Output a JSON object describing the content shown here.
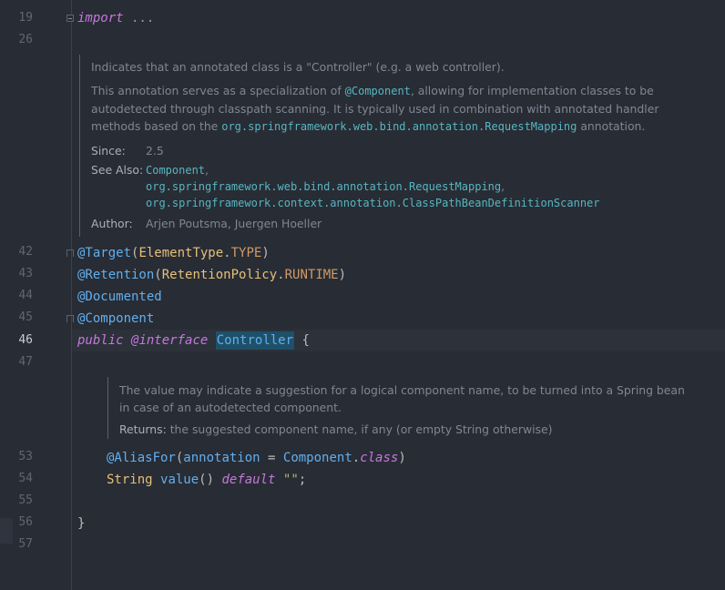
{
  "line_numbers": {
    "l19": "19",
    "l26": "26",
    "l42": "42",
    "l43": "43",
    "l44": "44",
    "l45": "45",
    "l46": "46",
    "l47": "47",
    "l53": "53",
    "l54": "54",
    "l55": "55",
    "l56": "56",
    "l57": "57"
  },
  "code": {
    "import_kw": "import",
    "import_ellipsis": " ...",
    "target_ann": "@Target",
    "target_open": "(",
    "target_cls": "ElementType",
    "target_dot": ".",
    "target_const": "TYPE",
    "target_close": ")",
    "retention_ann": "@Retention",
    "retention_open": "(",
    "retention_cls": "RetentionPolicy",
    "retention_dot": ".",
    "retention_const": "RUNTIME",
    "retention_close": ")",
    "documented_ann": "@Documented",
    "component_ann": "@Component",
    "public_kw": "public",
    "at_interface": "@interface",
    "controller_name": "Controller",
    "open_brace": "{",
    "aliasfor_ann": "@AliasFor",
    "aliasfor_open": "(",
    "aliasfor_param": "annotation",
    "aliasfor_eq": " = ",
    "aliasfor_cls": "Component",
    "aliasfor_dot": ".",
    "aliasfor_class_kw": "class",
    "aliasfor_close": ")",
    "string_type": "String",
    "value_method": "value",
    "value_parens": "()",
    "default_kw": "default",
    "empty_str": "\"\"",
    "semicolon": ";",
    "close_brace": "}"
  },
  "doc1": {
    "summary": "Indicates that an annotated class is a \"Controller\" (e.g. a web controller).",
    "para_1": "This annotation serves as a specialization of ",
    "para_link_component": "@Component",
    "para_2": ", allowing for implementation classes to be autodetected through classpath scanning. It is typically used in combination with annotated handler methods based on the ",
    "para_link_requestmapping": "org.springframework.web.bind.annotation.RequestMapping",
    "para_3": " annotation.",
    "since_label": "Since:",
    "since_value": "2.5",
    "see_also_label": "See Also:",
    "see_also_1": "Component",
    "see_also_2": "org.springframework.web.bind.annotation.RequestMapping",
    "see_also_3": "org.springframework.context.annotation.ClassPathBeanDefinitionScanner",
    "comma": ",",
    "author_label": "Author:",
    "author_value": "Arjen Poutsma, Juergen Hoeller"
  },
  "doc2": {
    "text": "The value may indicate a suggestion for a logical component name, to be turned into a Spring bean in case of an autodetected component.",
    "returns_label": "Returns:",
    "returns_value": "the suggested component name, if any (or empty String otherwise)"
  },
  "colors": {
    "background": "#282c34",
    "keyword": "#c678dd",
    "annotation": "#61afef",
    "class": "#e5c07b",
    "constant": "#d19a66",
    "string": "#98c379",
    "doc_link": "#56b6c2",
    "selection": "#1f5069"
  }
}
